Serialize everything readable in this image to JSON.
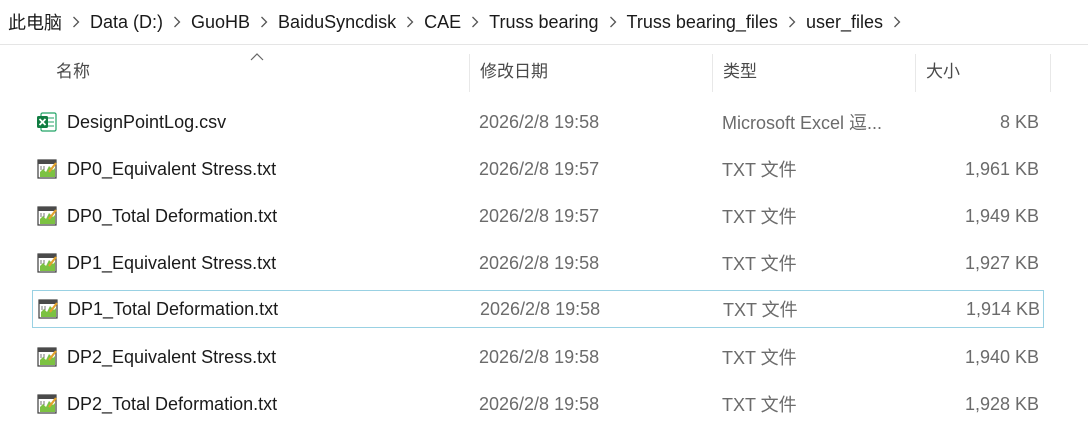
{
  "breadcrumb": [
    "此电脑",
    "Data (D:)",
    "GuoHB",
    "BaiduSyncdisk",
    "CAE",
    "Truss bearing",
    "Truss bearing_files",
    "user_files"
  ],
  "columns": {
    "name": "名称",
    "date": "修改日期",
    "type": "类型",
    "size": "大小"
  },
  "sort": {
    "column": "name",
    "direction": "ascending",
    "icon": "chevron-up-icon"
  },
  "files": [
    {
      "name": "DesignPointLog.csv",
      "date": "2026/2/8 19:58",
      "type": "Microsoft Excel 逗...",
      "size": "8 KB",
      "icon": "excel-file-icon"
    },
    {
      "name": "DP0_Equivalent Stress.txt",
      "date": "2026/2/8 19:57",
      "type": "TXT 文件",
      "size": "1,961 KB",
      "icon": "text-file-icon"
    },
    {
      "name": "DP0_Total Deformation.txt",
      "date": "2026/2/8 19:57",
      "type": "TXT 文件",
      "size": "1,949 KB",
      "icon": "text-file-icon"
    },
    {
      "name": "DP1_Equivalent Stress.txt",
      "date": "2026/2/8 19:58",
      "type": "TXT 文件",
      "size": "1,927 KB",
      "icon": "text-file-icon"
    },
    {
      "name": "DP1_Total Deformation.txt",
      "date": "2026/2/8 19:58",
      "type": "TXT 文件",
      "size": "1,914 KB",
      "icon": "text-file-icon",
      "focused": true
    },
    {
      "name": "DP2_Equivalent Stress.txt",
      "date": "2026/2/8 19:58",
      "type": "TXT 文件",
      "size": "1,940 KB",
      "icon": "text-file-icon"
    },
    {
      "name": "DP2_Total Deformation.txt",
      "date": "2026/2/8 19:58",
      "type": "TXT 文件",
      "size": "1,928 KB",
      "icon": "text-file-icon"
    }
  ],
  "colors": {
    "focus_border": "#99d1e3",
    "excel_green": "#107c41"
  }
}
